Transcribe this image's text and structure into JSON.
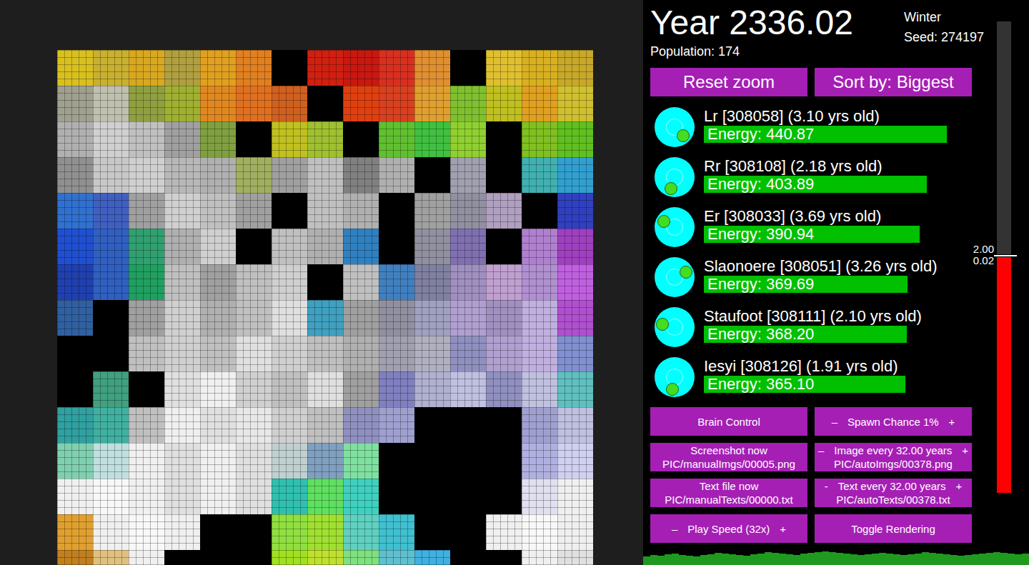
{
  "header": {
    "year": "Year 2336.02",
    "season": "Winter",
    "seed": "Seed: 274197",
    "population": "Population: 174"
  },
  "top_buttons": [
    "Reset zoom",
    "Sort by: Biggest"
  ],
  "creatures": [
    {
      "name": "Lr [308058] (3.10 yrs old)",
      "energy": "Energy: 440.87",
      "level": 0.907,
      "heading": 45
    },
    {
      "name": "Rr [308108] (2.18 yrs old)",
      "energy": "Energy: 403.89",
      "level": 0.832,
      "heading": 107
    },
    {
      "name": "Er [308033] (3.69 yrs old)",
      "energy": "Energy: 390.94",
      "level": 0.805,
      "heading": 210
    },
    {
      "name": "Slaonoere [308051] (3.26 yrs old)",
      "energy": "Energy: 369.69",
      "level": 0.76,
      "heading": 336
    },
    {
      "name": "Staufoot [308111] (2.10 yrs old)",
      "energy": "Energy: 368.20",
      "level": 0.757,
      "heading": 192
    },
    {
      "name": "Iesyi [308126] (1.91 yrs old)",
      "energy": "Energy: 365.10",
      "level": 0.752,
      "heading": 101
    }
  ],
  "controls": [
    {
      "kind": "button",
      "label": "Brain Control",
      "sub": ""
    },
    {
      "kind": "stepper",
      "minus": "–",
      "label": "Spawn Chance 1%",
      "plus": "+",
      "sub": ""
    },
    {
      "kind": "button",
      "label": "Screenshot now",
      "sub": "PIC/manualImgs/00005.png"
    },
    {
      "kind": "stepper",
      "minus": "–",
      "label": "Image every 32.00 years",
      "plus": "+",
      "sub": "PIC/autoImgs/00378.png"
    },
    {
      "kind": "button",
      "label": "Text file now",
      "sub": "PIC/manualTexts/00000.txt"
    },
    {
      "kind": "stepper",
      "minus": "-",
      "label": "Text every 32.00 years",
      "plus": "+",
      "sub": "PIC/autoTexts/00378.txt"
    },
    {
      "kind": "stepper",
      "minus": "–",
      "label": "Play Speed (32x)",
      "plus": "+",
      "sub": ""
    },
    {
      "kind": "button",
      "label": "Toggle Rendering",
      "sub": ""
    }
  ],
  "slider": {
    "level": 0.503,
    "labels": [
      "2.00",
      "0.02"
    ]
  },
  "map": {
    "tiles": [
      [
        "#d8c020",
        "#c8b030",
        "#d8a820",
        "#b0a040",
        "#e0a020",
        "#e08020",
        "#000000",
        "#d02010",
        "#c81810",
        "#d83020",
        "#e09030",
        "#000000",
        "#e0c030",
        "#d8b020",
        "#c8a828"
      ],
      [
        "#a0a090",
        "#c0c0b0",
        "#90a040",
        "#a0b030",
        "#e08820",
        "#e07020",
        "#d06020",
        "#000000",
        "#e04010",
        "#d84020",
        "#e0a030",
        "#80c030",
        "#c0c020",
        "#e0a020",
        "#d0c030"
      ],
      [
        "#b0b0b0",
        "#d0d0d0",
        "#c0c0c0",
        "#a0a0a0",
        "#80a040",
        "#000000",
        "#c0c020",
        "#a0c030",
        "#000000",
        "#60c030",
        "#40c040",
        "#90d030",
        "#000000",
        "#80c020",
        "#60c020"
      ],
      [
        "#909090",
        "#c8c8c8",
        "#d0d0d0",
        "#b8b8b8",
        "#b0b0b0",
        "#a0b060",
        "#a0a0a0",
        "#c0c0c0",
        "#808080",
        "#b0b0b0",
        "#000000",
        "#a0a0b0",
        "#000000",
        "#40b0b0",
        "#30a0d0"
      ],
      [
        "#3070d0",
        "#4060c0",
        "#a0a0a0",
        "#d0d0d0",
        "#c0c0c0",
        "#a0a0a0",
        "#000000",
        "#c0c0c0",
        "#b0b0b0",
        "#000000",
        "#a0a0a0",
        "#9090a0",
        "#b0a0c0",
        "#000000",
        "#3040c0"
      ],
      [
        "#2050d0",
        "#3060c0",
        "#30a070",
        "#b0b0b0",
        "#d0d0d0",
        "#000000",
        "#c0c0c0",
        "#b0b0b0",
        "#3080c0",
        "#000000",
        "#9090a0",
        "#8070b0",
        "#000000",
        "#b080d0",
        "#a040c0"
      ],
      [
        "#2040b0",
        "#3060c0",
        "#20a060",
        "#c0c0c0",
        "#a0a0a0",
        "#c0c0c0",
        "#d0d0d0",
        "#000000",
        "#c0c0c0",
        "#4080c0",
        "#8080a0",
        "#a090c0",
        "#c0a0d0",
        "#b090d0",
        "#c060e0"
      ],
      [
        "#3060a0",
        "#000000",
        "#a0a0a0",
        "#d0d0d0",
        "#b0b0b0",
        "#c0c0c0",
        "#e0e0e0",
        "#40a0c0",
        "#a0a0a0",
        "#9090a0",
        "#a0a0c0",
        "#b0a0d0",
        "#a090c0",
        "#c0b0e0",
        "#b050d0"
      ],
      [
        "#000000",
        "#000000",
        "#c0c0c0",
        "#d0d0d0",
        "#c0c0c0",
        "#e0e0e0",
        "#d0d0d0",
        "#c0c0c0",
        "#b0b0b0",
        "#a0a0b0",
        "#b0b0c0",
        "#9090c0",
        "#b0a0d0",
        "#c0b0e0",
        "#8090d0"
      ],
      [
        "#000000",
        "#40a080",
        "#000000",
        "#e0e0e0",
        "#f0f0f0",
        "#d0d0d0",
        "#c0c0c0",
        "#e0e0e0",
        "#a0a0a0",
        "#8080c0",
        "#b0b0d0",
        "#c0c0e0",
        "#9090c0",
        "#c0c0e0",
        "#60c0c0"
      ],
      [
        "#30a0a0",
        "#40b0a0",
        "#c0c0c0",
        "#f0f0f0",
        "#e0e0e0",
        "#e8e8e8",
        "#d0d0d0",
        "#c0c0c0",
        "#9090c0",
        "#a0a0d0",
        "#000000",
        "#000000",
        "#000000",
        "#a0a0d0",
        "#c0c0e0"
      ],
      [
        "#80d0b0",
        "#c0e0e0",
        "#f0f0f0",
        "#e0e0e0",
        "#f0f0f0",
        "#e0e0e0",
        "#c0d0d0",
        "#80a0c0",
        "#80e0a0",
        "#000000",
        "#000000",
        "#000000",
        "#000000",
        "#b0b0e0",
        "#d0d0f0"
      ],
      [
        "#f0f0f0",
        "#f8f8f8",
        "#f0f0f0",
        "#e0e0e0",
        "#f0f0f0",
        "#e0e0e0",
        "#30c0b0",
        "#60e060",
        "#40d0c0",
        "#000000",
        "#000000",
        "#000000",
        "#000000",
        "#e0e0f0",
        "#f0f0f0"
      ],
      [
        "#e0a030",
        "#f0f0f0",
        "#f8f8f8",
        "#f0f0f0",
        "#000000",
        "#000000",
        "#90e040",
        "#a0e030",
        "#60d0c0",
        "#40c0d0",
        "#000000",
        "#000000",
        "#f0f0f0",
        "#f8f8f8",
        "#f0f0f0"
      ],
      [
        "#c08020",
        "#e0c080",
        "#f0f0f0",
        "#000000",
        "#000000",
        "#000000",
        "#a0e020",
        "#c0e030",
        "#80e080",
        "#60c0d0",
        "#40b0e0",
        "#000000",
        "#000000",
        "#f0f0f0",
        "#e0e0e0"
      ]
    ]
  },
  "history": {
    "values": [
      12,
      14,
      13,
      15,
      16,
      14,
      13,
      12,
      14,
      15,
      17,
      16,
      15,
      14,
      13,
      15,
      16,
      18,
      17,
      16,
      15,
      14,
      16,
      17,
      18,
      19,
      18,
      17,
      16,
      15,
      14,
      15,
      16,
      17,
      16,
      15,
      14,
      15,
      16,
      18,
      17,
      16,
      15,
      14,
      13,
      14,
      15,
      16,
      17,
      18,
      17,
      16,
      15,
      16
    ]
  }
}
